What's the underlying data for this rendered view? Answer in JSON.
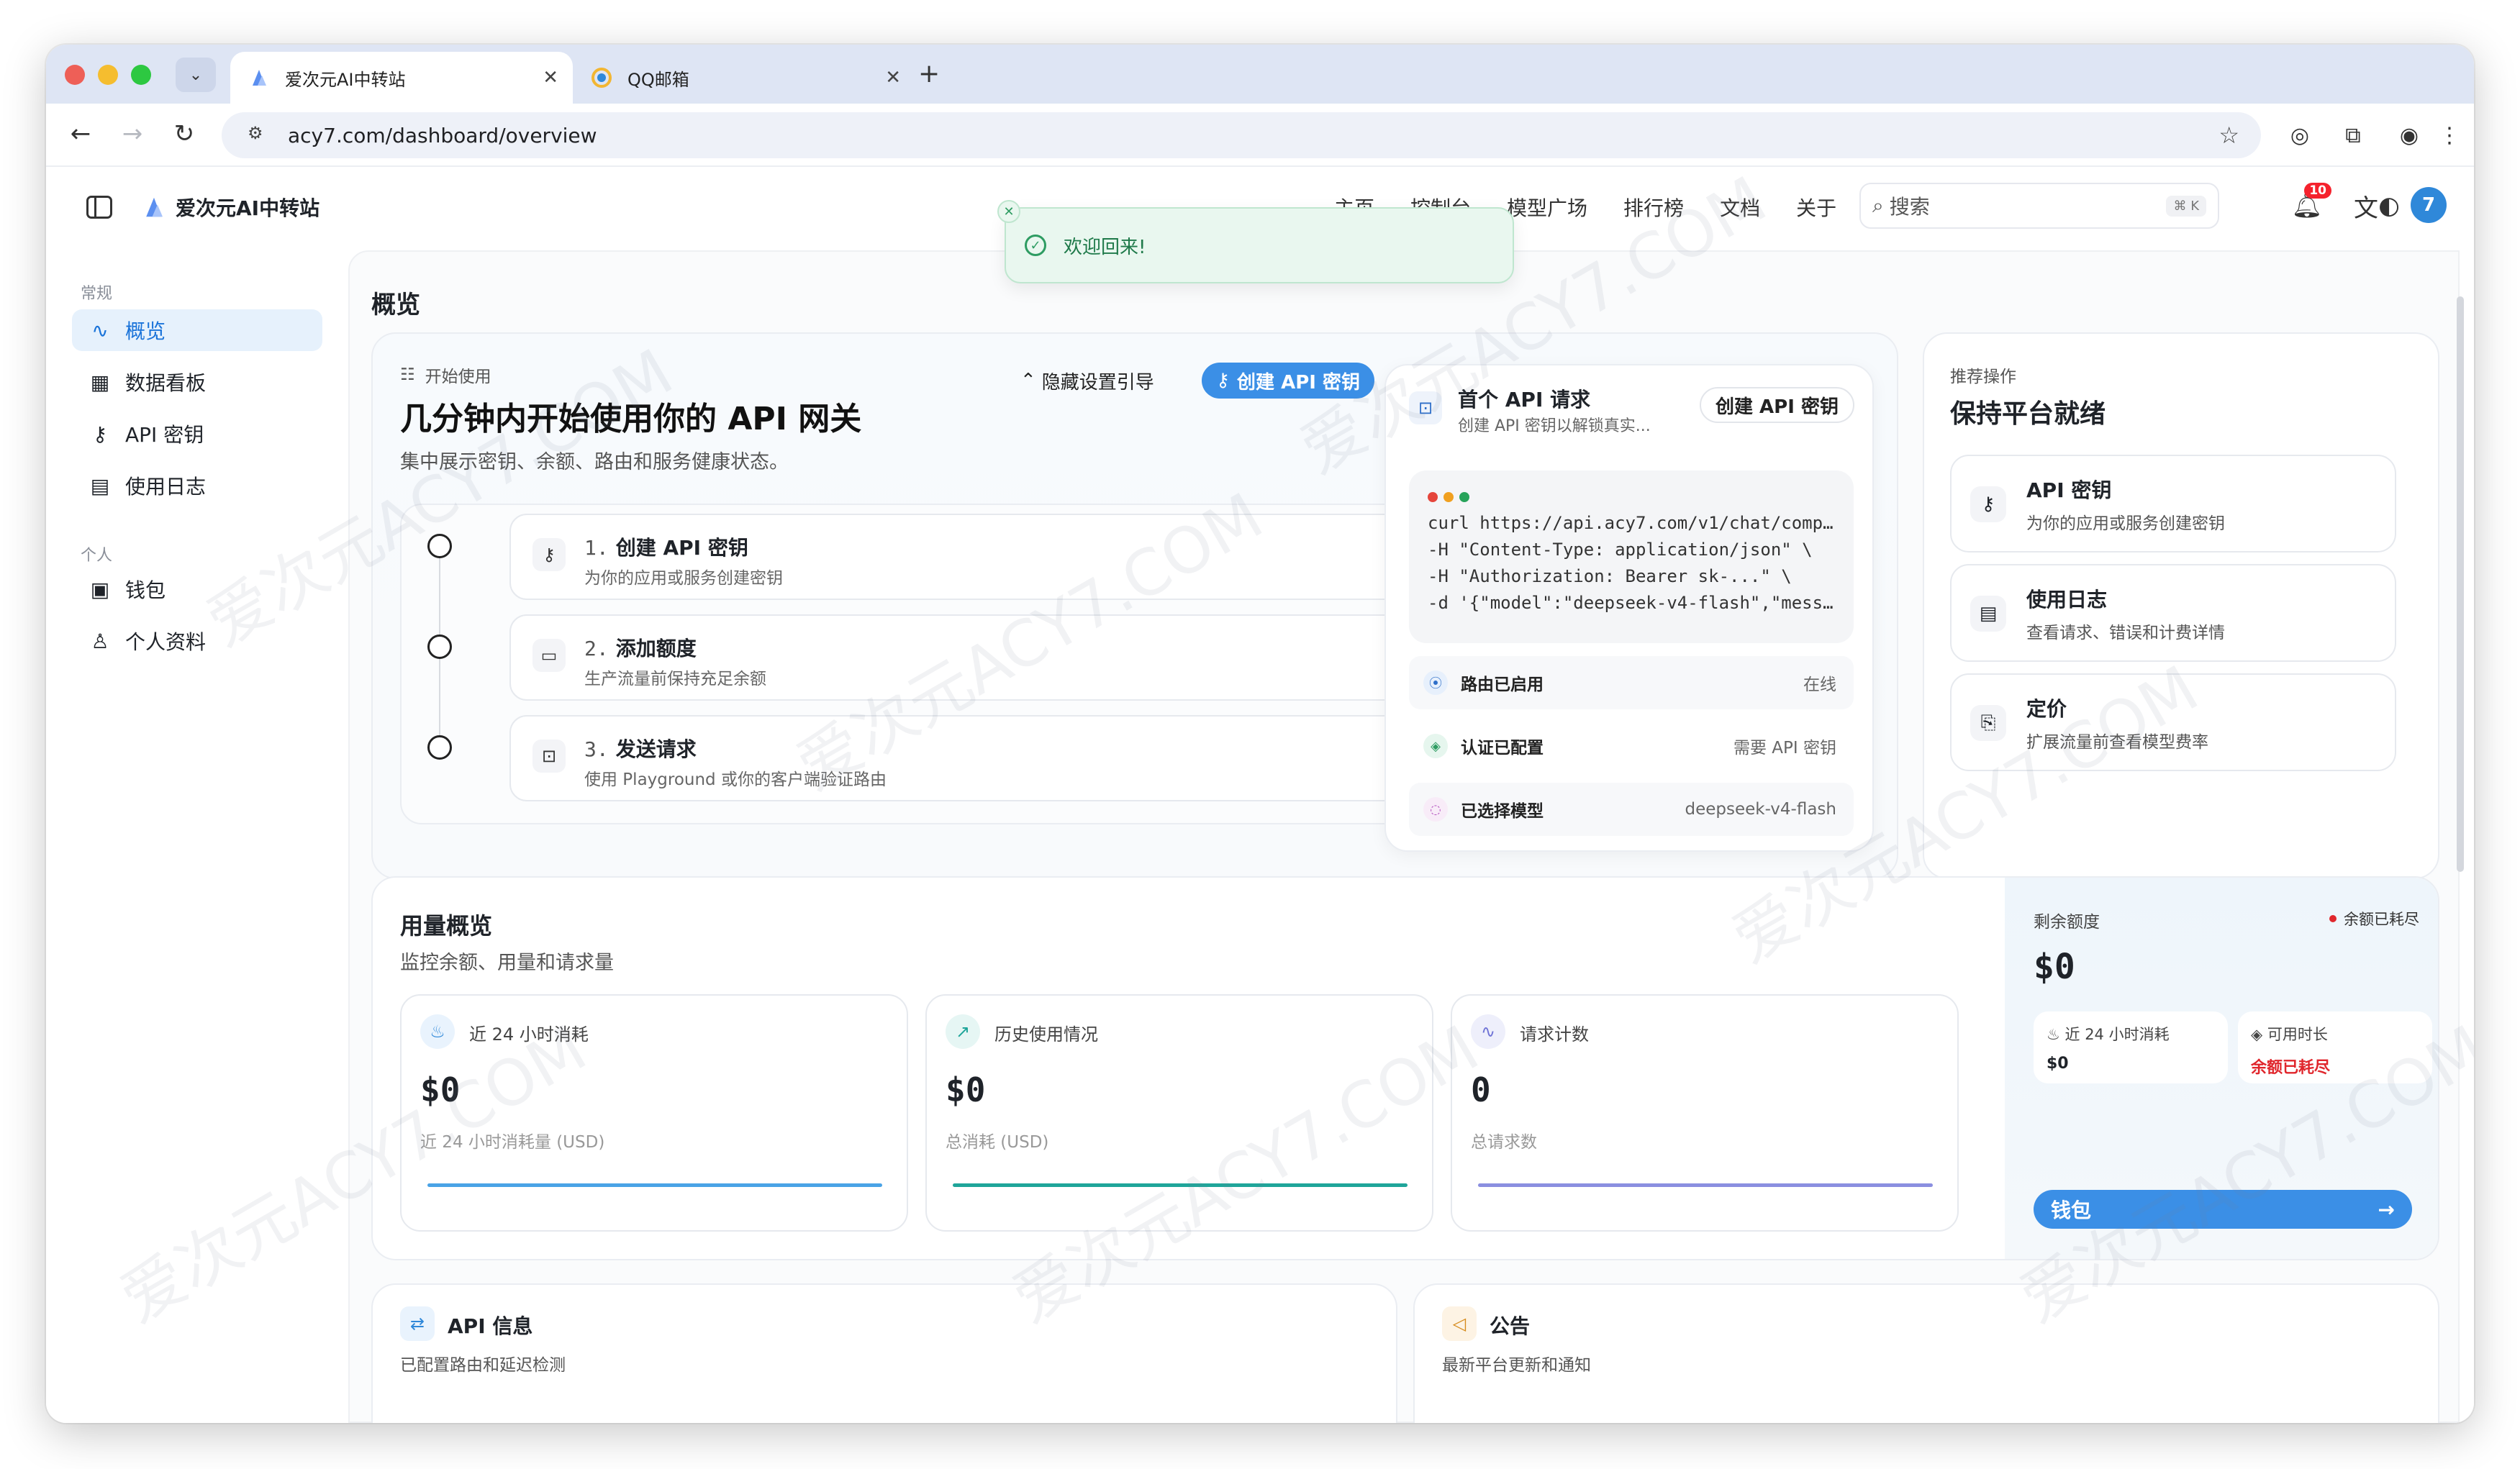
{
  "browser": {
    "tabs": [
      {
        "title": "爱次元AI中转站",
        "active": true
      },
      {
        "title": "QQ邮箱",
        "active": false
      }
    ],
    "url": "acy7.com/dashboard/overview"
  },
  "topnav": {
    "brand": "爱次元AI中转站",
    "links": [
      "主页",
      "控制台",
      "模型广场",
      "排行榜",
      "文档",
      "关于"
    ],
    "search_placeholder": "搜索",
    "search_shortcut": "⌘ K",
    "notification_count": "10",
    "avatar_initial": "7"
  },
  "toast": {
    "message": "欢迎回来!"
  },
  "sidebar": {
    "group1": "常规",
    "items1": [
      {
        "label": "概览",
        "icon": "activity-icon",
        "active": true
      },
      {
        "label": "数据看板",
        "icon": "grid-icon"
      },
      {
        "label": "API 密钥",
        "icon": "key-icon"
      },
      {
        "label": "使用日志",
        "icon": "file-icon"
      }
    ],
    "group2": "个人",
    "items2": [
      {
        "label": "钱包",
        "icon": "wallet-icon"
      },
      {
        "label": "个人资料",
        "icon": "user-icon"
      }
    ]
  },
  "page": {
    "title": "概览"
  },
  "getting_started": {
    "kicker": "开始使用",
    "title": "几分钟内开始使用你的 API 网关",
    "subtitle": "集中展示密钥、余额、路由和服务健康状态。",
    "hide_label": "隐藏设置引导",
    "create_key_label": "创建 API 密钥",
    "steps": [
      {
        "num": "1.",
        "title": "创建 API 密钥",
        "desc": "为你的应用或服务创建密钥",
        "icon": "key-icon"
      },
      {
        "num": "2.",
        "title": "添加额度",
        "desc": "生产流量前保持充足余额",
        "icon": "card-icon"
      },
      {
        "num": "3.",
        "title": "发送请求",
        "desc": "使用 Playground 或你的客户端验证路由",
        "icon": "terminal-icon"
      }
    ]
  },
  "first_request": {
    "title": "首个 API 请求",
    "subtitle": "创建 API 密钥以解锁真实...",
    "button": "创建 API 密钥",
    "code_lines": [
      "curl https://api.acy7.com/v1/chat/comp…",
      "-H \"Content-Type: application/json\" \\",
      "-H \"Authorization: Bearer sk-...\" \\",
      "-d '{\"model\":\"deepseek-v4-flash\",\"mess…"
    ],
    "status": [
      {
        "label": "路由已启用",
        "value": "在线",
        "icon": "signal-icon"
      },
      {
        "label": "认证已配置",
        "value": "需要 API 密钥",
        "icon": "shield-icon"
      },
      {
        "label": "已选择模型",
        "value": "deepseek-v4-flash",
        "icon": "model-icon"
      }
    ]
  },
  "recommended": {
    "kicker": "推荐操作",
    "title": "保持平台就绪",
    "items": [
      {
        "title": "API 密钥",
        "desc": "为你的应用或服务创建密钥",
        "icon": "key-icon"
      },
      {
        "title": "使用日志",
        "desc": "查看请求、错误和计费详情",
        "icon": "file-icon"
      },
      {
        "title": "定价",
        "desc": "扩展流量前查看模型费率",
        "icon": "book-icon"
      }
    ]
  },
  "usage": {
    "title": "用量概览",
    "subtitle": "监控余额、用量和请求量",
    "metrics": [
      {
        "label": "近 24 小时消耗",
        "value": "$0",
        "desc": "近 24 小时消耗量 (USD)",
        "icon": "flame-icon",
        "color": "#4aa3e6"
      },
      {
        "label": "历史使用情况",
        "value": "$0",
        "desc": "总消耗 (USD)",
        "icon": "trend-icon",
        "color": "#1fa59a"
      },
      {
        "label": "请求计数",
        "value": "0",
        "desc": "总请求数",
        "icon": "activity-icon",
        "color": "#8b8fe0"
      }
    ],
    "balance": {
      "label": "剩余额度",
      "status": "余额已耗尽",
      "value": "$0",
      "mini1_label": "近 24 小时消耗",
      "mini1_value": "$0",
      "mini2_label": "可用时长",
      "mini2_value": "余额已耗尽",
      "wallet_button": "钱包"
    }
  },
  "api_info": {
    "title": "API 信息",
    "subtitle": "已配置路由和延迟检测"
  },
  "announcements": {
    "title": "公告",
    "subtitle": "最新平台更新和通知"
  },
  "watermark": "爱次元ACY7.COM"
}
